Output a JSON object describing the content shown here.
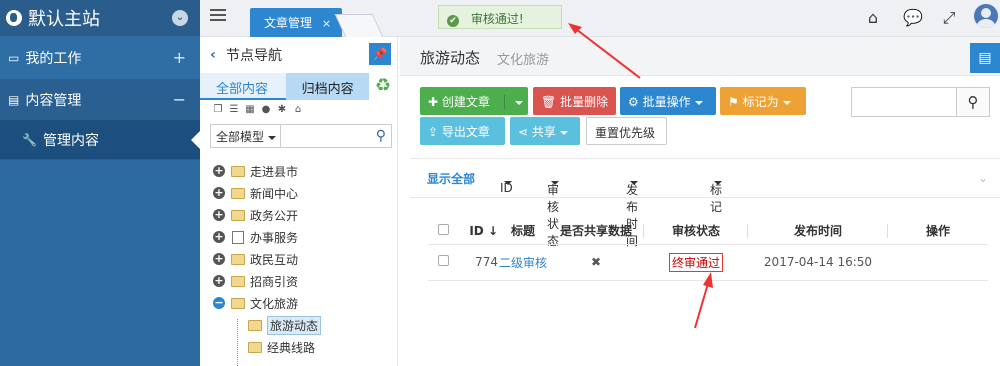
{
  "sidebar": {
    "brand": "默认主站",
    "items": [
      {
        "label": "我的工作",
        "toggle": "+"
      },
      {
        "label": "内容管理",
        "toggle": "−"
      },
      {
        "label": "管理内容"
      }
    ]
  },
  "topbar": {
    "tab_label": "文章管理",
    "tab_close": "×",
    "toast": "审核通过!"
  },
  "node_panel": {
    "title": "节点导航",
    "tab_all": "全部内容",
    "tab_archive": "归档内容",
    "model_select": "全部模型",
    "tree": [
      {
        "label": "走进县市",
        "toggle": "+"
      },
      {
        "label": "新闻中心",
        "toggle": "+"
      },
      {
        "label": "政务公开",
        "toggle": "+"
      },
      {
        "label": "办事服务",
        "toggle": "+"
      },
      {
        "label": "政民互动",
        "toggle": "+"
      },
      {
        "label": "招商引资",
        "toggle": "+"
      },
      {
        "label": "文化旅游",
        "toggle": "−"
      }
    ],
    "children": [
      {
        "label": "旅游动态"
      },
      {
        "label": "经典线路"
      }
    ]
  },
  "main": {
    "title": "旅游动态",
    "subtitle": "文化旅游",
    "buttons": {
      "create": "创建文章",
      "batch_delete": "批量删除",
      "batch_ops": "批量操作",
      "mark_as": "标记为",
      "export": "导出文章",
      "share": "共享",
      "reset_priority": "重置优先级"
    },
    "filters": {
      "all": "显示全部",
      "id": "ID",
      "audit_status": "审核状态",
      "publish_time": "发布时间",
      "mark": "标记"
    },
    "table": {
      "headers": [
        "ID",
        "标题",
        "是否共享数据",
        "审核状态",
        "发布时间",
        "操作"
      ],
      "rows": [
        {
          "id": "774",
          "title": "二级审核",
          "shared": "✖",
          "status": "终审通过",
          "time": "2017-04-14 16:50",
          "ops": ""
        }
      ]
    }
  },
  "colors": {
    "sidebar": "#2c6aa0",
    "accent": "#2c86d0",
    "green": "#4cae4c",
    "red": "#d9534f",
    "orange": "#eea236",
    "annotation": "#e33"
  }
}
